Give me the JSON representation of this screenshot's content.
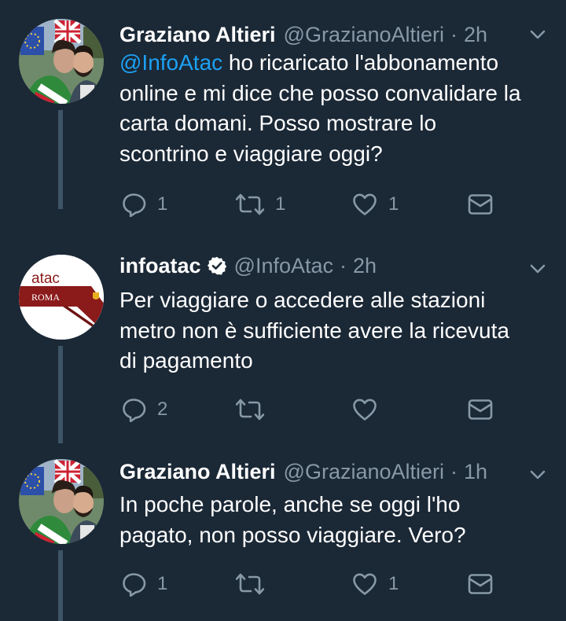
{
  "colors": {
    "background": "#1b2836",
    "text": "#ffffff",
    "muted": "#8899a6",
    "accent": "#1da1f2",
    "thread_line": "#3d5466"
  },
  "tweets": [
    {
      "name": "Graziano Altieri",
      "handle": "@GrazianoAltieri",
      "separator": "·",
      "time": "2h",
      "verified": false,
      "text_mention": "@InfoAtac",
      "text_lines": [
        " ho ricaricato l'abbonamento",
        "online e mi dice che posso convalidare la",
        "carta domani. Posso mostrare lo",
        "scontrino e viaggiare oggi?"
      ],
      "reply_count": "1",
      "retweet_count": "1",
      "like_count": "1",
      "icons": [
        "reply-icon",
        "retweet-icon",
        "like-icon",
        "message-icon"
      ]
    },
    {
      "name": "infoatac",
      "handle": "@InfoAtac",
      "separator": "·",
      "time": "2h",
      "verified": true,
      "avatar_text": "atac",
      "avatar_subtext": "ROMA",
      "text_lines": [
        "Per viaggiare o accedere alle stazioni",
        "metro non è sufficiente avere la ricevuta",
        "di pagamento"
      ],
      "reply_count": "2",
      "retweet_count": "",
      "like_count": "",
      "icons": [
        "reply-icon",
        "retweet-icon",
        "like-icon",
        "message-icon"
      ]
    },
    {
      "name": "Graziano Altieri",
      "handle": "@GrazianoAltieri",
      "separator": "·",
      "time": "1h",
      "verified": false,
      "text_lines": [
        "In poche parole, anche se oggi l'ho",
        "pagato, non posso viaggiare. Vero?"
      ],
      "reply_count": "1",
      "retweet_count": "",
      "like_count": "1",
      "icons": [
        "reply-icon",
        "retweet-icon",
        "like-icon",
        "message-icon"
      ]
    }
  ]
}
